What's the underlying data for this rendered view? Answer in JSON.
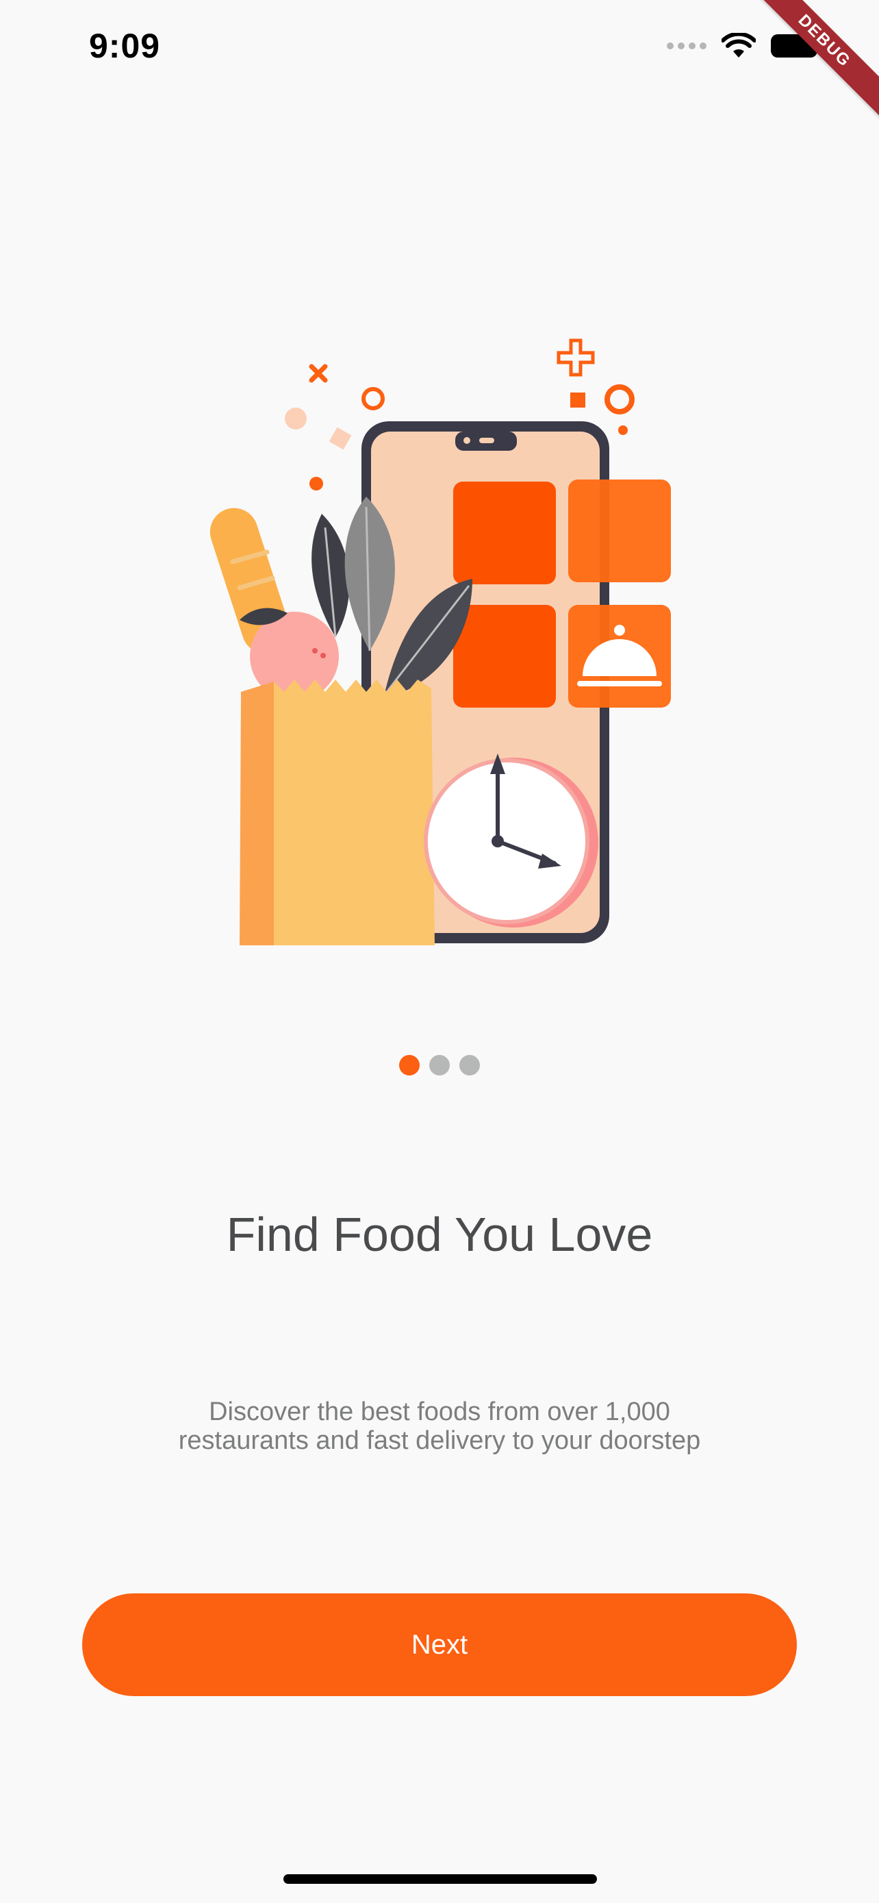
{
  "status_bar": {
    "time": "9:09",
    "icons": [
      "cellular-icon",
      "wifi-icon",
      "battery-icon"
    ]
  },
  "debug_banner": "DEBUG",
  "onboarding": {
    "pager": {
      "total": 3,
      "active_index": 0
    },
    "title": "Find Food You Love",
    "description_lines": [
      "Discover the best foods from over 1,000",
      "restaurants and fast delivery to your doorstep"
    ],
    "next_label": "Next"
  },
  "colors": {
    "accent": "#fc6011",
    "title": "#4a4b4d",
    "body_text": "#7c7d7e",
    "dot_inactive": "#b6b7b7",
    "background": "#f9f9f9"
  }
}
